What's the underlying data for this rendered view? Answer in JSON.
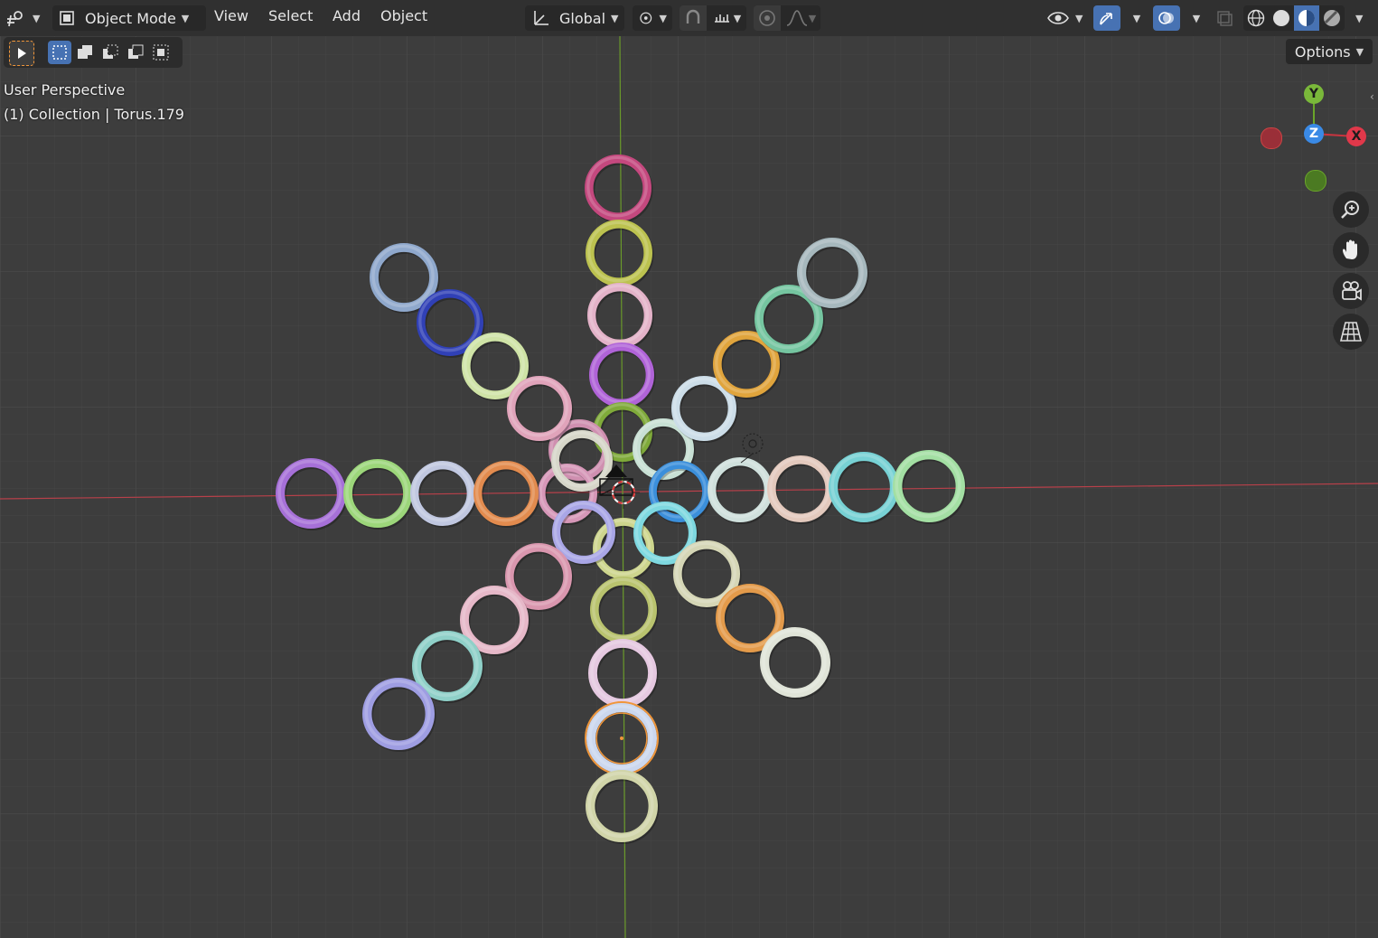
{
  "header": {
    "editor_type_icon": "editor-type-icon",
    "mode_label": "Object Mode",
    "menus": [
      "View",
      "Select",
      "Add",
      "Object"
    ],
    "orientation_label": "Global"
  },
  "overlay": {
    "line1": "User Perspective",
    "line2": "(1) Collection | Torus.179"
  },
  "options_label": "Options",
  "gizmo": {
    "y": "Y",
    "z": "Z",
    "x": "X"
  },
  "colors": {
    "header_bg": "#303030",
    "viewport_bg": "#3d3d3d",
    "x_axis": "#d2333f",
    "y_axis": "#6aa52a",
    "z_axis": "#2f86e0",
    "selection": "#f0963a",
    "active_button": "#4772b3"
  },
  "toruses": [
    {
      "color": "#c4487e"
    },
    {
      "color": "#bcc24f"
    },
    {
      "color": "#e3b2c8"
    },
    {
      "color": "#b063d8"
    },
    {
      "color": "#7faa3a"
    },
    {
      "color": "#c8e0d4"
    },
    {
      "color": "#cf8fb0"
    },
    {
      "color": "#d697b8"
    },
    {
      "color": "#cdd58d"
    },
    {
      "color": "#b9c36e"
    },
    {
      "color": "#e5c8e0"
    },
    {
      "color": "#cbd7ee",
      "selected": true
    },
    {
      "color": "#d0d4a8"
    },
    {
      "color": "#8fa8cc"
    },
    {
      "color": "#3040b6"
    },
    {
      "color": "#cfe3a6"
    },
    {
      "color": "#e0a3ba"
    },
    {
      "color": "#d6d6c9"
    },
    {
      "color": "#a670d8"
    },
    {
      "color": "#9cd67a"
    },
    {
      "color": "#c0c7e0"
    },
    {
      "color": "#e28b4e"
    },
    {
      "color": "#a9a6e6"
    },
    {
      "color": "#ccdde8"
    },
    {
      "color": "#e0a43c"
    },
    {
      "color": "#75c5a0"
    },
    {
      "color": "#a6b8bd"
    },
    {
      "color": "#3b8fdb"
    },
    {
      "color": "#cfe0dc"
    },
    {
      "color": "#e3c9bd"
    },
    {
      "color": "#77d1d4"
    },
    {
      "color": "#a3dfa3"
    },
    {
      "color": "#7ed8e0"
    },
    {
      "color": "#d996ae"
    },
    {
      "color": "#e6b8c8"
    },
    {
      "color": "#8fd0c8"
    },
    {
      "color": "#9e9de2"
    },
    {
      "color": "#d5d6b6"
    },
    {
      "color": "#e39a4a"
    },
    {
      "color": "#e0e4d8"
    }
  ]
}
